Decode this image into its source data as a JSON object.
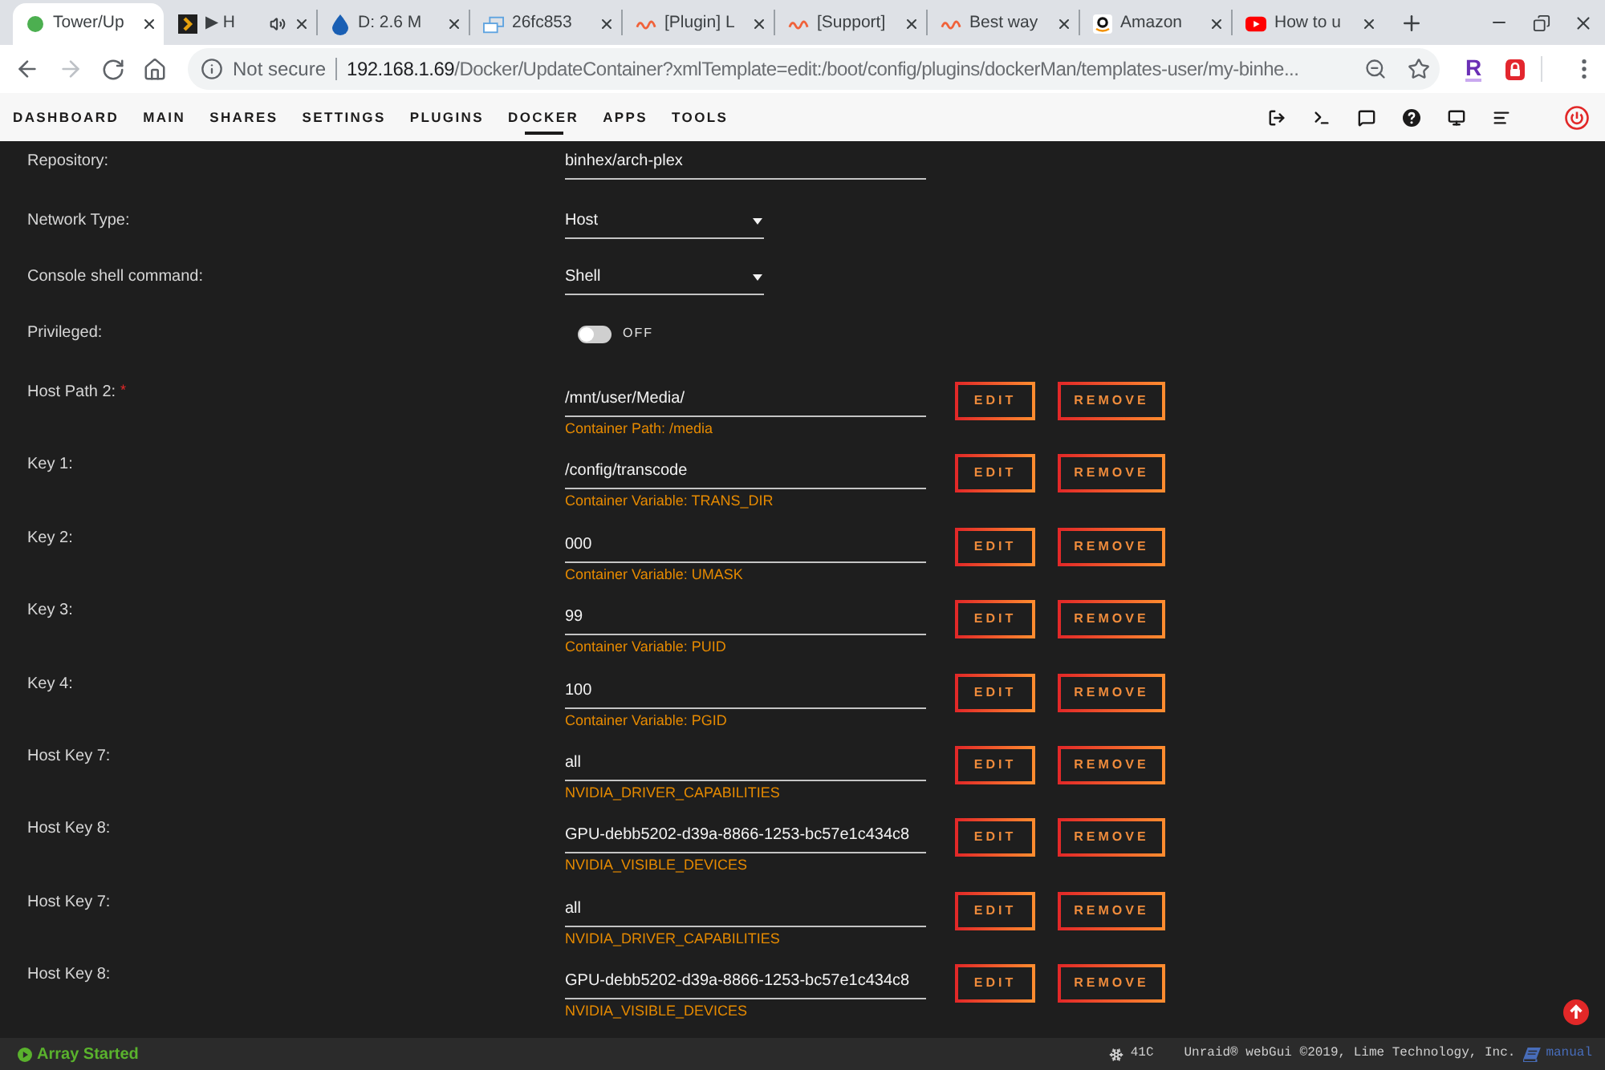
{
  "browser": {
    "tabs": [
      {
        "kind": "dot",
        "title": "Tower/Up",
        "audio": false,
        "selected": true
      },
      {
        "kind": "chevron",
        "title": "▶ H",
        "audio": true,
        "selected": false
      },
      {
        "kind": "droplet",
        "title": "D: 2.6 M",
        "audio": false,
        "selected": false
      },
      {
        "kind": "screens",
        "title": "26fc853",
        "audio": false,
        "selected": false
      },
      {
        "kind": "wave",
        "title": "[Plugin] L",
        "audio": false,
        "selected": false
      },
      {
        "kind": "wave",
        "title": "[Support]",
        "audio": false,
        "selected": false
      },
      {
        "kind": "wave",
        "title": "Best way",
        "audio": false,
        "selected": false
      },
      {
        "kind": "smile",
        "title": "Amazon",
        "audio": false,
        "selected": false
      },
      {
        "kind": "play",
        "title": "How to u",
        "audio": false,
        "selected": false
      }
    ],
    "security": "Not secure",
    "url_host": "192.168.1.69",
    "url_path": "/Docker/UpdateContainer?xmlTemplate=edit:/boot/config/plugins/dockerMan/templates-user/my-binhe...",
    "extension": "R"
  },
  "nav": {
    "items": [
      {
        "label": "DASHBOARD",
        "selected": false
      },
      {
        "label": "MAIN",
        "selected": false
      },
      {
        "label": "SHARES",
        "selected": false
      },
      {
        "label": "SETTINGS",
        "selected": false
      },
      {
        "label": "PLUGINS",
        "selected": false
      },
      {
        "label": "DOCKER",
        "selected": true
      },
      {
        "label": "APPS",
        "selected": false
      },
      {
        "label": "TOOLS",
        "selected": false
      }
    ]
  },
  "settings": [
    {
      "kind": "text",
      "label": "Repository:",
      "value": "binhex/arch-plex"
    },
    {
      "kind": "select",
      "label": "Network Type:",
      "value": "Host"
    },
    {
      "kind": "select",
      "label": "Console shell command:",
      "value": "Shell"
    },
    {
      "kind": "toggle",
      "label": "Privileged:",
      "on": false,
      "state_label": "OFF"
    }
  ],
  "config": [
    {
      "label": "Host Path 2:",
      "marker": "*",
      "value": "/mnt/user/Media/",
      "hint": "Container Path: /media",
      "edit": "EDIT",
      "remove": "REMOVE"
    },
    {
      "label": "Key 1:",
      "value": "/config/transcode",
      "hint": "Container Variable: TRANS_DIR",
      "edit": "EDIT",
      "remove": "REMOVE"
    },
    {
      "label": "Key 2:",
      "value": "000",
      "hint": "Container Variable: UMASK",
      "edit": "EDIT",
      "remove": "REMOVE"
    },
    {
      "label": "Key 3:",
      "value": "99",
      "hint": "Container Variable: PUID",
      "edit": "EDIT",
      "remove": "REMOVE"
    },
    {
      "label": "Key 4:",
      "value": "100",
      "hint": "Container Variable: PGID",
      "edit": "EDIT",
      "remove": "REMOVE"
    },
    {
      "label": "Host Key 7:",
      "value": "all",
      "hint": "NVIDIA_DRIVER_CAPABILITIES",
      "edit": "EDIT",
      "remove": "REMOVE"
    },
    {
      "label": "Host Key 8:",
      "value": "GPU-debb5202-d39a-8866-1253-bc57e1c434c8",
      "hint": "NVIDIA_VISIBLE_DEVICES",
      "edit": "EDIT",
      "remove": "REMOVE"
    },
    {
      "label": "Host Key 7:",
      "value": "all",
      "hint": "NVIDIA_DRIVER_CAPABILITIES",
      "edit": "EDIT",
      "remove": "REMOVE"
    },
    {
      "label": "Host Key 8:",
      "value": "GPU-debb5202-d39a-8866-1253-bc57e1c434c8",
      "hint": "NVIDIA_VISIBLE_DEVICES",
      "edit": "EDIT",
      "remove": "REMOVE"
    }
  ],
  "footer": {
    "status": "Array Started",
    "temperature": "41C",
    "copyright": "Unraid® webGui ©2019, Lime Technology, Inc.",
    "manual": "manual"
  }
}
